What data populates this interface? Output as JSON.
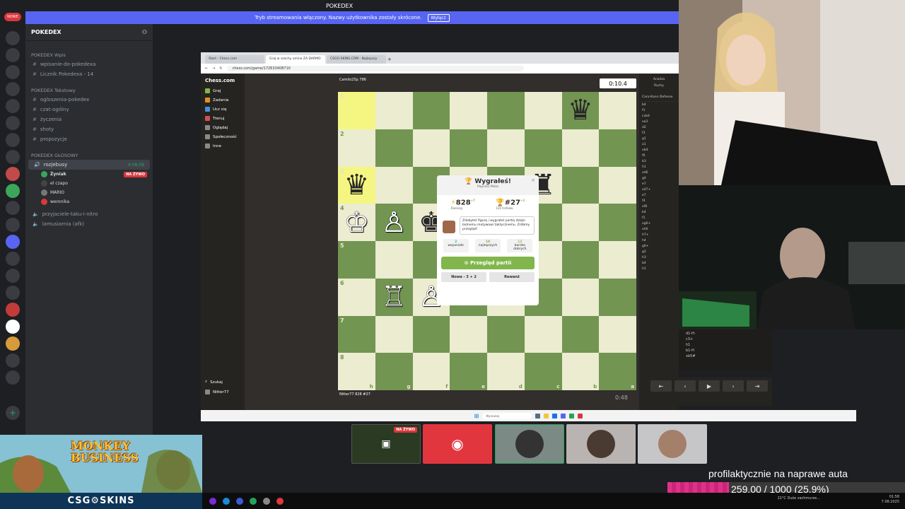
{
  "discord": {
    "window_title": "POKEDEX",
    "stream_mode_notice": "Tryb streamowania włączony. Nazwy użytkownika zostały skrócone.",
    "stream_mode_button": "Wyłącz",
    "server_name": "POKEDEX",
    "new_badge": "NOWE",
    "categories": [
      {
        "name": "POKEDEX Wpis",
        "channels": [
          "wpisanie-do-pokedexa",
          "Licznik Pokedexa - 14"
        ]
      },
      {
        "name": "POKEDEX Tekstowy",
        "channels": [
          "ogloszenia-pokedex",
          "czat-ogólny",
          "życzenia",
          "shoty",
          "propozycje"
        ]
      }
    ],
    "voice_category": "POKEDEX GŁOSOWY",
    "voice_channel": {
      "name": "rozjebusy",
      "timer": "4:08:08"
    },
    "voice_users": [
      {
        "name": "Żyniak",
        "live": "NA ŻYWO"
      },
      {
        "name": "el czapo"
      },
      {
        "name": "MARIO"
      },
      {
        "name": "weronika"
      }
    ],
    "other_voice_channels": [
      "przyjaciele-taku-i-nitro",
      "lamusiarnia (afk)"
    ]
  },
  "browser": {
    "tabs": [
      "Start - Chess.com",
      "Graj w szachy online ZA DARMO",
      "CSGO-SKINS.COM - Najlepszy"
    ],
    "url": "chess.com/game/172633408710"
  },
  "chess": {
    "logo": "Chess.com",
    "nav": [
      "Graj",
      "Zadania",
      "Ucz się",
      "Trenuj",
      "Oglądaj",
      "Społeczność",
      "Inne"
    ],
    "search_label": "Szukaj",
    "bottom_user": "Nitter77",
    "top_player": {
      "name": "Camilo25p",
      "rating": "786"
    },
    "bottom_player": {
      "name": "Nitter77",
      "rating": "828",
      "rank": "#27"
    },
    "clock_top": "0:10.4",
    "clock_bottom": "0:48",
    "ranks": [
      "1",
      "2",
      "3",
      "4",
      "5",
      "6",
      "7",
      "8"
    ],
    "files": [
      "h",
      "g",
      "f",
      "e",
      "d",
      "c",
      "b",
      "a"
    ],
    "modal": {
      "title": "Wygrałeś!",
      "subtitle": "Poprzez Mata",
      "rating_value": "828",
      "rating_change": "+7",
      "rating_label": "Ranking",
      "rank_value": "#27",
      "rank_change": "+1",
      "rank_label": "120 trofeów",
      "coach_text": "Zdobyłeś figurę i wygrałeś partię dzięki ładnemu motywowi taktycznemu. Zróbmy przegląd!",
      "stat1": {
        "value": "2",
        "label": "wspaniałe"
      },
      "stat2": {
        "value": "19",
        "label": "najlepszych"
      },
      "stat3": {
        "value": "12",
        "label": "bardzo dobrych"
      },
      "review_button": "Przegląd partii",
      "new_button": "Nowa - 3 + 2",
      "rematch_button": "Rewanż"
    },
    "analysis_tabs": [
      "Analiza",
      "Ruchy"
    ],
    "opening": "Caro-Kann Defense",
    "moves": [
      "b4",
      "f1",
      "cxb4",
      "xa3",
      "d2",
      "f3",
      "g1",
      "a1",
      "xb4",
      "f6",
      "b3",
      "h1",
      "xd6",
      "g4",
      "e7",
      "xd7+",
      "e7",
      "f4",
      "xf8",
      "b4",
      "f1",
      "xg6+",
      "xh6",
      "h7+",
      "h4",
      "g6+",
      "g2",
      "h3",
      "b4",
      "h1"
    ],
    "overlay_moves": [
      "d1-H-",
      "c3+",
      "h1",
      "b1-H",
      "xb5#"
    ]
  },
  "windows": {
    "search_placeholder": "Wyszukaj",
    "weather": "21°C Duże zachmurze...",
    "time": "01:58",
    "date": "7.08.2025"
  },
  "stream": {
    "goal_text": "profilaktycznie na naprawe auta",
    "goal_label": "259.00 / 1000 (25.9%)",
    "goal_progress": 0.259,
    "tile_live": "NA ŻYWO",
    "banner_title_1": "MONKEY",
    "banner_title_2": "BUSINESS",
    "sponsor": "CSG⚙SKINS"
  }
}
